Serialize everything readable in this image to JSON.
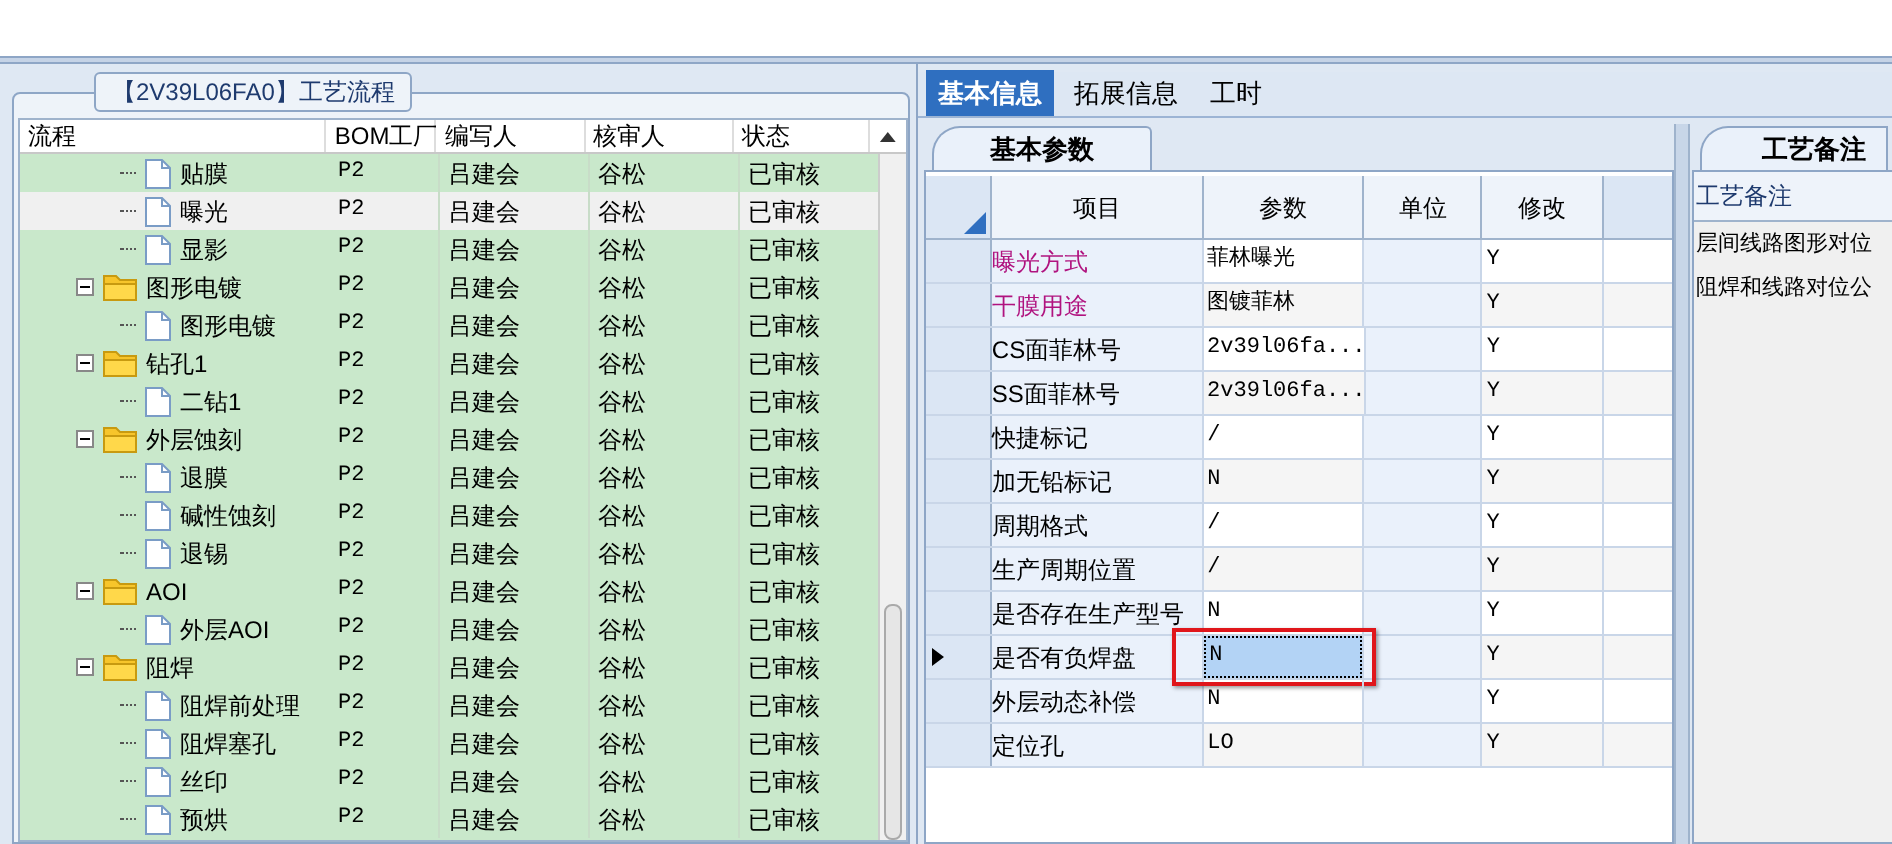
{
  "flow_panel": {
    "title": "【2V39L06FA0】工艺流程",
    "columns": [
      "流程",
      "BOM工厂",
      "编写人",
      "核审人",
      "状态"
    ],
    "tree": [
      {
        "children": [
          {
            "name": "贴膜",
            "factory": "P2",
            "writer": "吕建会",
            "reviewer": "谷松",
            "status": "已审核",
            "selected": false
          },
          {
            "name": "曝光",
            "factory": "P2",
            "writer": "吕建会",
            "reviewer": "谷松",
            "status": "已审核",
            "selected": true
          },
          {
            "name": "显影",
            "factory": "P2",
            "writer": "吕建会",
            "reviewer": "谷松",
            "status": "已审核",
            "selected": false
          }
        ]
      },
      {
        "name": "图形电镀",
        "factory": "P2",
        "writer": "吕建会",
        "reviewer": "谷松",
        "status": "已审核",
        "selected": false,
        "expanded": true,
        "children": [
          {
            "name": "图形电镀",
            "factory": "P2",
            "writer": "吕建会",
            "reviewer": "谷松",
            "status": "已审核",
            "selected": false
          }
        ]
      },
      {
        "name": "钻孔1",
        "factory": "P2",
        "writer": "吕建会",
        "reviewer": "谷松",
        "status": "已审核",
        "selected": false,
        "expanded": true,
        "children": [
          {
            "name": "二钻1",
            "factory": "P2",
            "writer": "吕建会",
            "reviewer": "谷松",
            "status": "已审核",
            "selected": false
          }
        ]
      },
      {
        "name": "外层蚀刻",
        "factory": "P2",
        "writer": "吕建会",
        "reviewer": "谷松",
        "status": "已审核",
        "selected": false,
        "expanded": true,
        "children": [
          {
            "name": "退膜",
            "factory": "P2",
            "writer": "吕建会",
            "reviewer": "谷松",
            "status": "已审核",
            "selected": false
          },
          {
            "name": "碱性蚀刻",
            "factory": "P2",
            "writer": "吕建会",
            "reviewer": "谷松",
            "status": "已审核",
            "selected": false
          },
          {
            "name": "退锡",
            "factory": "P2",
            "writer": "吕建会",
            "reviewer": "谷松",
            "status": "已审核",
            "selected": false
          }
        ]
      },
      {
        "name": "AOI",
        "factory": "P2",
        "writer": "吕建会",
        "reviewer": "谷松",
        "status": "已审核",
        "selected": false,
        "expanded": true,
        "children": [
          {
            "name": "外层AOI",
            "factory": "P2",
            "writer": "吕建会",
            "reviewer": "谷松",
            "status": "已审核",
            "selected": false
          }
        ]
      },
      {
        "name": "阻焊",
        "factory": "P2",
        "writer": "吕建会",
        "reviewer": "谷松",
        "status": "已审核",
        "selected": false,
        "expanded": true,
        "children": [
          {
            "name": "阻焊前处理",
            "factory": "P2",
            "writer": "吕建会",
            "reviewer": "谷松",
            "status": "已审核",
            "selected": false
          },
          {
            "name": "阻焊塞孔",
            "factory": "P2",
            "writer": "吕建会",
            "reviewer": "谷松",
            "status": "已审核",
            "selected": false
          },
          {
            "name": "丝印",
            "factory": "P2",
            "writer": "吕建会",
            "reviewer": "谷松",
            "status": "已审核",
            "selected": false
          },
          {
            "name": "预烘",
            "factory": "P2",
            "writer": "吕建会",
            "reviewer": "谷松",
            "status": "已审核",
            "selected": false
          }
        ]
      }
    ]
  },
  "tabs": [
    {
      "label": "基本信息",
      "selected": true
    },
    {
      "label": "拓展信息",
      "selected": false
    },
    {
      "label": "工时",
      "selected": false
    }
  ],
  "params_panel": {
    "tab": "基本参数",
    "columns": [
      "项目",
      "参数",
      "单位",
      "修改"
    ],
    "rows": [
      {
        "item": "曝光方式",
        "value": "菲林曝光",
        "unit": "",
        "modify": "Y",
        "emphasized": true,
        "selected": false,
        "callout": false
      },
      {
        "item": "干膜用途",
        "value": "图镀菲林",
        "unit": "",
        "modify": "Y",
        "emphasized": true,
        "selected": false,
        "callout": false
      },
      {
        "item": "CS面菲林号",
        "value": "2v39l06fa...",
        "unit": "",
        "modify": "Y",
        "emphasized": false,
        "selected": false,
        "callout": false
      },
      {
        "item": "SS面菲林号",
        "value": "2v39l06fa...",
        "unit": "",
        "modify": "Y",
        "emphasized": false,
        "selected": false,
        "callout": false
      },
      {
        "item": "快捷标记",
        "value": "/",
        "unit": "",
        "modify": "Y",
        "emphasized": false,
        "selected": false,
        "callout": false
      },
      {
        "item": "加无铅标记",
        "value": "N",
        "unit": "",
        "modify": "Y",
        "emphasized": false,
        "selected": false,
        "callout": false
      },
      {
        "item": "周期格式",
        "value": "/",
        "unit": "",
        "modify": "Y",
        "emphasized": false,
        "selected": false,
        "callout": false
      },
      {
        "item": "生产周期位置",
        "value": "/",
        "unit": "",
        "modify": "Y",
        "emphasized": false,
        "selected": false,
        "callout": false
      },
      {
        "item": "是否存在生产型号",
        "value": "N",
        "unit": "",
        "modify": "Y",
        "emphasized": false,
        "selected": false,
        "callout": false
      },
      {
        "item": "是否有负焊盘",
        "value": "N",
        "unit": "",
        "modify": "Y",
        "emphasized": false,
        "selected": true,
        "callout": true
      },
      {
        "item": "外层动态补偿",
        "value": "N",
        "unit": "",
        "modify": "Y",
        "emphasized": false,
        "selected": false,
        "callout": false
      },
      {
        "item": "定位孔",
        "value": "LO",
        "unit": "",
        "modify": "Y",
        "emphasized": false,
        "selected": false,
        "callout": false
      }
    ]
  },
  "notes_panel": {
    "tab": "工艺备注",
    "header": "工艺备注",
    "lines": [
      "层间线路图形对位",
      "阻焊和线路对位公"
    ]
  }
}
